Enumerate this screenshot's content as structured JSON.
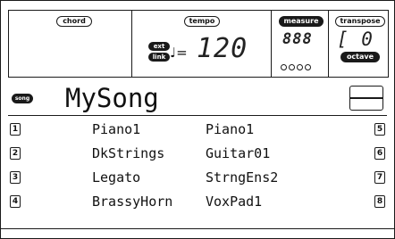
{
  "status_bar": {
    "chord_label": "chord",
    "tempo_label": "tempo",
    "ext_label": "ext",
    "link_label": "link",
    "tempo_symbol": "♩=",
    "tempo_value": "120",
    "measure_label": "measure",
    "measure_value": "888",
    "transpose_label": "transpose",
    "transpose_value": "[ 0",
    "octave_label": "octave"
  },
  "song": {
    "icon_label": "song",
    "name": "MySong"
  },
  "tracks": [
    {
      "num": "1",
      "name": "Piano1"
    },
    {
      "num": "2",
      "name": "DkStrings"
    },
    {
      "num": "3",
      "name": "Legato"
    },
    {
      "num": "4",
      "name": "BrassyHorn"
    },
    {
      "num": "5",
      "name": "Piano1"
    },
    {
      "num": "6",
      "name": "Guitar01"
    },
    {
      "num": "7",
      "name": "StrngEns2"
    },
    {
      "num": "8",
      "name": "VoxPad1"
    }
  ]
}
